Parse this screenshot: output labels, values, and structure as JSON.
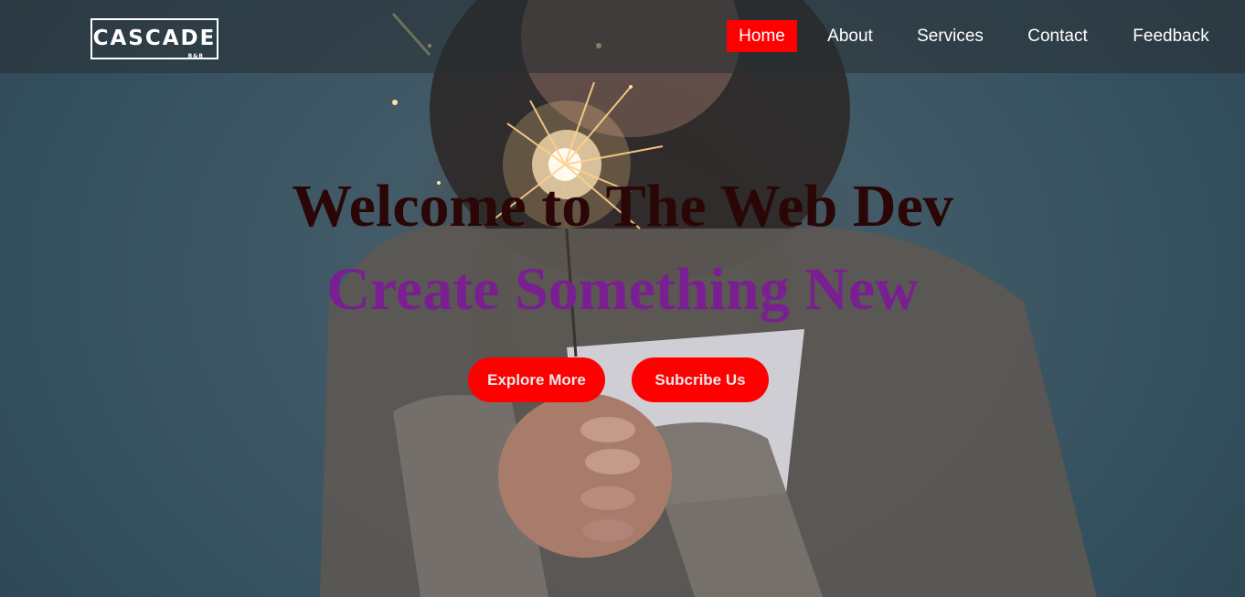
{
  "brand": {
    "name": "CASCADE",
    "tagline": "B&B"
  },
  "nav": {
    "items": [
      {
        "label": "Home",
        "active": true
      },
      {
        "label": "About",
        "active": false
      },
      {
        "label": "Services",
        "active": false
      },
      {
        "label": "Contact",
        "active": false
      },
      {
        "label": "Feedback",
        "active": false
      }
    ]
  },
  "hero": {
    "title": "Welcome to The Web Dev",
    "subtitle": "Create Something New",
    "primary_button": "Explore More",
    "secondary_button": "Subcribe Us",
    "background_image": "woman holding a lit sparkler"
  },
  "colors": {
    "accent": "#ff0000",
    "title": "#2a0606",
    "subtitle": "#7a1f92",
    "nav_text": "#ffffff"
  }
}
